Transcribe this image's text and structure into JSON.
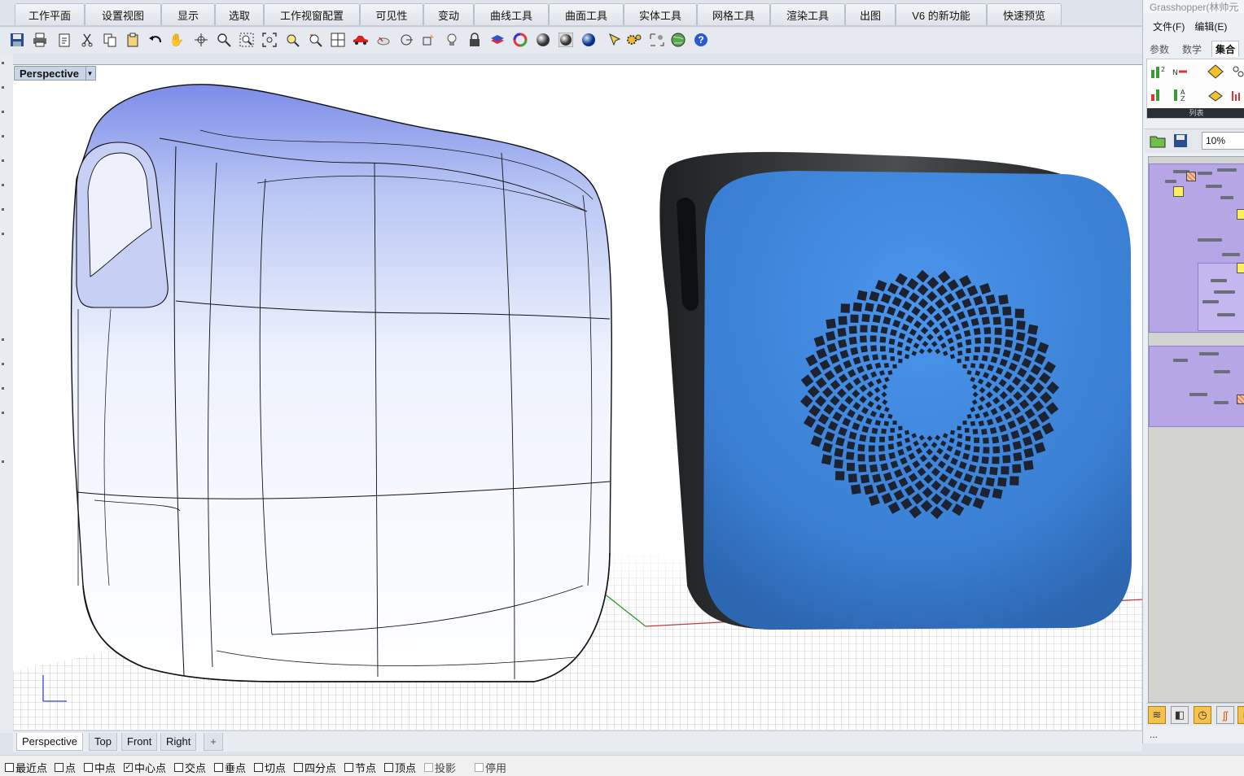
{
  "ribbon_tabs": [
    "工作平面",
    "设置视图",
    "显示",
    "选取",
    "工作视窗配置",
    "可见性",
    "变动",
    "曲线工具",
    "曲面工具",
    "实体工具",
    "网格工具",
    "渲染工具",
    "出图",
    "V6 的新功能",
    "快速预览"
  ],
  "toolbar_icons": [
    "save-icon",
    "print-icon",
    "import-icon",
    "cut-icon",
    "copy-icon",
    "paste-icon",
    "undo-icon",
    "pan-hand-icon",
    "rotate-view-icon",
    "zoom-icon",
    "zoom-window-icon",
    "zoom-extents-icon",
    "zoom-selected-icon",
    "zoom-reset-icon",
    "four-viewports-icon",
    "car-icon",
    "hide-icon",
    "point-icon",
    "select-icon",
    "light-bulb-icon",
    "lock-icon",
    "layers-icon",
    "color-wheel-icon",
    "sphere-shaded-icon",
    "render-preview-icon",
    "blue-sphere-icon",
    "cursor-icon",
    "gear-icon",
    "grasshopper-icon",
    "globe-icon",
    "help-icon"
  ],
  "viewport": {
    "active_name": "Perspective",
    "tabs": [
      "Perspective",
      "Top",
      "Front",
      "Right"
    ],
    "add_tab_label": "+"
  },
  "osnaps": [
    {
      "label": "最近点",
      "checked": false
    },
    {
      "label": "点",
      "checked": false
    },
    {
      "label": "中点",
      "checked": false
    },
    {
      "label": "中心点",
      "checked": true
    },
    {
      "label": "交点",
      "checked": false
    },
    {
      "label": "垂点",
      "checked": false
    },
    {
      "label": "切点",
      "checked": false
    },
    {
      "label": "四分点",
      "checked": false
    },
    {
      "label": "节点",
      "checked": false
    },
    {
      "label": "顶点",
      "checked": false
    },
    {
      "label": "投影",
      "checked": false,
      "disabled": true
    },
    {
      "label": "停用",
      "checked": false,
      "disabled": true
    }
  ],
  "grasshopper": {
    "title": "Grasshopper(林帅元",
    "menu": [
      "文件(F)",
      "编辑(E)"
    ],
    "tabs": [
      "参数",
      "数学",
      "集合"
    ],
    "active_tab": "集合",
    "group_label": "列表",
    "zoom": "10%",
    "status": "..."
  },
  "colors": {
    "speaker_blue": "#3f8be0",
    "speaker_shell": "#2f3233",
    "gh_group": "#b6a6e6",
    "viewport_label": "#c9d5e6"
  }
}
